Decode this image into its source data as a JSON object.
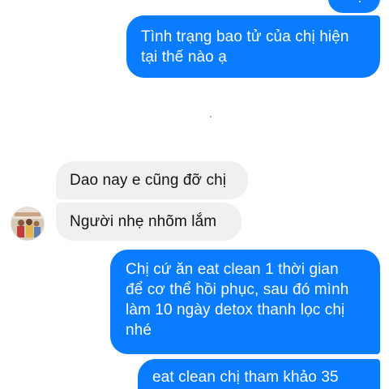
{
  "conversation": {
    "messages": [
      {
        "direction": "outgoing",
        "text": "Dạ"
      },
      {
        "direction": "outgoing",
        "lines": [
          "Tình trạng bao tử của chị hiện",
          "tại thế nào ạ"
        ]
      },
      {
        "direction": "incoming",
        "text": "Dao nay e cũng đỡ chị"
      },
      {
        "direction": "incoming",
        "text": "Người nhẹ nhõm lắm"
      },
      {
        "direction": "outgoing",
        "lines": [
          "Chị cứ ăn eat clean 1 thời gian",
          "để cơ thể hồi phục, sau đó mình",
          "làm 10 ngày detox thanh lọc chị",
          "nhé"
        ]
      },
      {
        "direction": "outgoing",
        "text": "eat clean chị tham khảo 35"
      }
    ]
  },
  "contact": {
    "avatar_icon": "profile-photo-icon"
  },
  "colors": {
    "outgoing_bubble": "#0a7cff",
    "incoming_bubble": "#f1f0f0",
    "outgoing_text": "#ffffff",
    "incoming_text": "#141414"
  }
}
